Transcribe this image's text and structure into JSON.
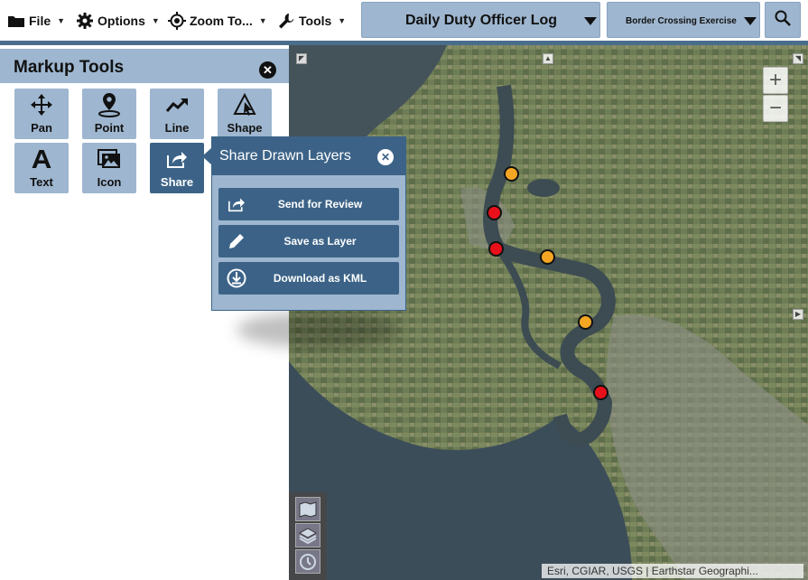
{
  "toolbar": {
    "menus": [
      {
        "label": "File",
        "icon": "folder-icon"
      },
      {
        "label": "Options",
        "icon": "gear-icon"
      },
      {
        "label": "Zoom To...",
        "icon": "crosshair-icon"
      },
      {
        "label": "Tools",
        "icon": "wrench-icon"
      }
    ],
    "log_title": "Daily Duty Officer Log",
    "exercise": "Border Crossing Exercise",
    "search_icon": "search-icon"
  },
  "panel": {
    "title": "Markup Tools",
    "tools": [
      {
        "label": "Pan",
        "icon": "move-icon"
      },
      {
        "label": "Point",
        "icon": "map-pin-icon"
      },
      {
        "label": "Line",
        "icon": "trend-line-icon"
      },
      {
        "label": "Shape",
        "icon": "triangle-shape-icon"
      },
      {
        "label": "Text",
        "icon": "text-icon"
      },
      {
        "label": "Icon",
        "icon": "image-icon"
      },
      {
        "label": "Share",
        "icon": "share-icon",
        "active": true
      }
    ]
  },
  "share_popup": {
    "title": "Share Drawn Layers",
    "buttons": [
      {
        "label": "Send for Review",
        "icon": "share-icon"
      },
      {
        "label": "Save as Layer",
        "icon": "pencil-icon"
      },
      {
        "label": "Download as KML",
        "icon": "download-icon"
      }
    ]
  },
  "map": {
    "zoom_in": "+",
    "zoom_out": "−",
    "attribution": "Esri, CGIAR, USGS | Earthstar Geographi...",
    "marker_colors": {
      "warning": "#f5a623",
      "alert": "#e8101a"
    },
    "accent": "#3c6387",
    "panel_bg": "#9eb6cf"
  }
}
